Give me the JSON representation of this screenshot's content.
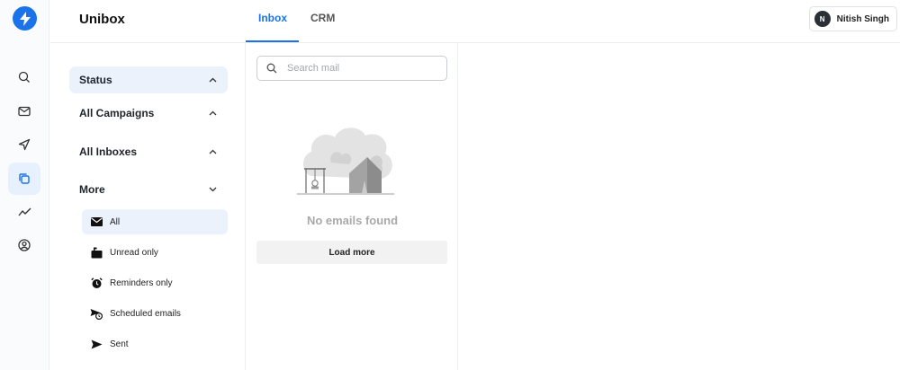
{
  "app": {
    "name": "Unibox"
  },
  "tabs": [
    {
      "label": "Inbox",
      "active": true
    },
    {
      "label": "CRM",
      "active": false
    }
  ],
  "user": {
    "initial": "N",
    "name": "Nitish Singh"
  },
  "rail": [
    {
      "icon": "search-icon"
    },
    {
      "icon": "mail-icon"
    },
    {
      "icon": "send-icon"
    },
    {
      "icon": "copy-icon",
      "active": true
    },
    {
      "icon": "analytics-icon"
    },
    {
      "icon": "user-circle-icon"
    }
  ],
  "filters": {
    "status": {
      "label": "Status",
      "expanded": true
    },
    "campaigns": {
      "label": "All Campaigns",
      "expanded": true
    },
    "inboxes": {
      "label": "All Inboxes",
      "expanded": true
    },
    "more": {
      "label": "More",
      "expanded": false
    },
    "more_items": [
      {
        "label": "All",
        "icon": "envelope-icon",
        "active": true
      },
      {
        "label": "Unread only",
        "icon": "mailbox-icon"
      },
      {
        "label": "Reminders only",
        "icon": "alarm-clock-icon"
      },
      {
        "label": "Scheduled emails",
        "icon": "scheduled-send-icon"
      },
      {
        "label": "Sent",
        "icon": "send-icon"
      }
    ]
  },
  "mail": {
    "search_placeholder": "Search mail",
    "empty_text": "No emails found",
    "load_more": "Load more"
  },
  "colors": {
    "accent": "#1a73e8",
    "active_bg": "#ebf2fc"
  }
}
